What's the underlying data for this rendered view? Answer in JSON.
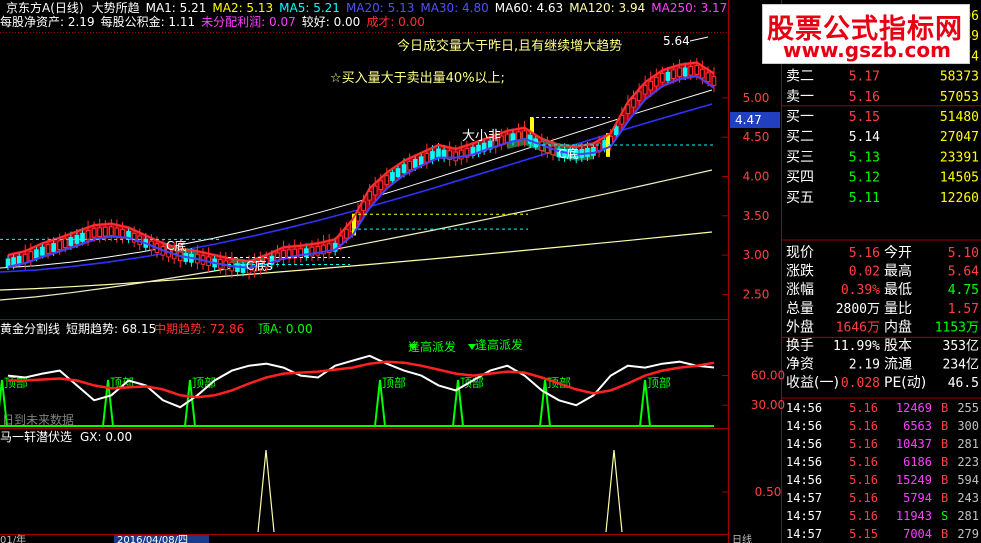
{
  "header": {
    "row1": [
      {
        "text": "京东方A(日线)",
        "color": "#ffffff"
      },
      {
        "text": "大势所趋",
        "color": "#ffffff"
      },
      {
        "text": "MA1: 5.21",
        "color": "#ffffff"
      },
      {
        "text": "MA2: 5.13",
        "color": "#ffff00"
      },
      {
        "text": "MA5: 5.21",
        "color": "#00ffff"
      },
      {
        "text": "MA20: 5.13",
        "color": "#5050ff"
      },
      {
        "text": "MA30: 4.80",
        "color": "#5050ff"
      },
      {
        "text": "MA60: 4.63",
        "color": "#ffffff"
      },
      {
        "text": "MA120: 3.94",
        "color": "#ffffaa"
      },
      {
        "text": "MA250: 3.17",
        "color": "#ff40ff"
      }
    ],
    "row2": [
      {
        "text": "每股净资产: 2.19",
        "color": "#ffffff"
      },
      {
        "text": "每股公积金: 1.11",
        "color": "#ffffff"
      },
      {
        "text": "未分配利润: 0.07",
        "color": "#ff40ff"
      },
      {
        "text": "较好: 0.00",
        "color": "#ffffff"
      },
      {
        "text": "成才: 0.00",
        "color": "#ff3030"
      }
    ]
  },
  "annotations": {
    "volume_note": "今日成交量大于昨日,且有继续增大趋势",
    "buy_note": "☆买入量大于卖出量40%以上;",
    "da_xiao_fei": "大小非",
    "c_di": "C底",
    "c_di_alt": "C底s",
    "high_label": "5.64",
    "price_tag": "4.47",
    "future_note": "日到未来数据"
  },
  "panes": {
    "mid": {
      "title": "黄金分割线",
      "short_label": "短期趋势: 68.15",
      "mid_label": "中期趋势: 72.86",
      "top_label": "顶A: 0.00",
      "ding": "顶部",
      "peak_note": "逢高派发"
    },
    "bottom": {
      "title": "马一轩潜伏选",
      "gx": "GX: 0.00"
    }
  },
  "axis": {
    "date_label": "2016/04/08/四",
    "left_label": "01/年",
    "right_label": "日线"
  },
  "chart_data": {
    "type": "line",
    "title": "京东方A(日线)",
    "y_price_ticks": [
      "5.00",
      "4.50",
      "4.00",
      "3.50",
      "3.00",
      "2.50"
    ],
    "y_mid_ticks": [
      "60.00",
      "30.00"
    ],
    "y_bottom_ticks": [
      "0.50"
    ],
    "price_range": [
      2.2,
      5.8
    ],
    "high_mark": 5.64,
    "last_price": 4.47,
    "series": [
      {
        "name": "MA1",
        "values": [
          2.9,
          2.95,
          3.05,
          3.12,
          3.2,
          3.28,
          3.3,
          3.25,
          3.15,
          3.05,
          2.98,
          2.95,
          2.9,
          2.85,
          2.82,
          2.9,
          3.0,
          3.02,
          3.05,
          3.1,
          3.35,
          3.75,
          3.95,
          4.1,
          4.2,
          4.3,
          4.25,
          4.32,
          4.4,
          4.48,
          4.52,
          4.38,
          4.3,
          4.28,
          4.32,
          4.45,
          4.85,
          5.1,
          5.25,
          5.32,
          5.35,
          5.21
        ]
      },
      {
        "name": "MA2",
        "values": [
          2.85,
          2.9,
          2.98,
          3.05,
          3.12,
          3.2,
          3.24,
          3.22,
          3.15,
          3.06,
          2.99,
          2.95,
          2.9,
          2.86,
          2.84,
          2.88,
          2.96,
          3.0,
          3.03,
          3.07,
          3.25,
          3.6,
          3.85,
          4.02,
          4.14,
          4.24,
          4.24,
          4.28,
          4.36,
          4.43,
          4.48,
          4.4,
          4.32,
          4.28,
          4.3,
          4.38,
          4.7,
          4.98,
          5.15,
          5.24,
          5.28,
          5.13
        ]
      }
    ],
    "mid_series": [
      {
        "name": "短期趋势",
        "values": [
          60,
          58,
          62,
          65,
          50,
          35,
          40,
          55,
          50,
          35,
          28,
          40,
          55,
          65,
          70,
          72,
          68,
          60,
          58,
          70,
          75,
          80,
          72,
          65,
          60,
          50,
          45,
          55,
          65,
          70,
          60,
          45,
          35,
          30,
          40,
          60,
          70,
          68,
          72,
          74,
          70,
          68.15
        ]
      },
      {
        "name": "中期趋势",
        "values": [
          55,
          55,
          56,
          57,
          55,
          50,
          47,
          48,
          49,
          46,
          40,
          38,
          40,
          45,
          52,
          58,
          62,
          63,
          64,
          66,
          68,
          72,
          74,
          73,
          70,
          66,
          62,
          60,
          62,
          64,
          63,
          58,
          52,
          46,
          42,
          45,
          52,
          60,
          65,
          68,
          70,
          72.86
        ]
      }
    ]
  },
  "quote": {
    "sell": [
      {
        "label": "卖五",
        "price": "5.20",
        "vol": "26296"
      },
      {
        "label": "卖四",
        "price": "5.19",
        "vol": "20349"
      },
      {
        "label": "卖三",
        "price": "5.18",
        "vol": "42474"
      },
      {
        "label": "卖二",
        "price": "5.17",
        "vol": "58373"
      },
      {
        "label": "卖一",
        "price": "5.16",
        "vol": "57053"
      }
    ],
    "buy": [
      {
        "label": "买一",
        "price": "5.15",
        "vol": "51480"
      },
      {
        "label": "买二",
        "price": "5.14",
        "vol": "27047"
      },
      {
        "label": "买三",
        "price": "5.13",
        "vol": "23391"
      },
      {
        "label": "买四",
        "price": "5.12",
        "vol": "14505"
      },
      {
        "label": "买五",
        "price": "5.11",
        "vol": "12260"
      }
    ],
    "stats": [
      {
        "l1": "现价",
        "v1": "5.16",
        "l2": "今开",
        "v2": "5.10"
      },
      {
        "l1": "涨跌",
        "v1": "0.02",
        "l2": "最高",
        "v2": "5.64"
      },
      {
        "l1": "涨幅",
        "v1": "0.39%",
        "l2": "最低",
        "v2": "4.75"
      },
      {
        "l1": "总量",
        "v1": "2800万",
        "l2": "量比",
        "v2": "1.57"
      },
      {
        "l1": "外盘",
        "v1": "1646万",
        "l2": "内盘",
        "v2": "1153万"
      },
      {
        "l1": "换手",
        "v1": "11.99%",
        "l2": "股本",
        "v2": "353亿"
      },
      {
        "l1": "净资",
        "v1": "2.19",
        "l2": "流通",
        "v2": "234亿"
      },
      {
        "l1": "收益(一)",
        "v1": "0.028",
        "l2": "PE(动)",
        "v2": "46.5"
      }
    ],
    "ticks": [
      {
        "time": "14:56",
        "price": "5.16",
        "vol": "12469",
        "bs": "B",
        "n": "255"
      },
      {
        "time": "14:56",
        "price": "5.16",
        "vol": "6563",
        "bs": "B",
        "n": "300"
      },
      {
        "time": "14:56",
        "price": "5.16",
        "vol": "10437",
        "bs": "B",
        "n": "281"
      },
      {
        "time": "14:56",
        "price": "5.16",
        "vol": "6186",
        "bs": "B",
        "n": "223"
      },
      {
        "time": "14:56",
        "price": "5.16",
        "vol": "15249",
        "bs": "B",
        "n": "594"
      },
      {
        "time": "14:57",
        "price": "5.16",
        "vol": "5794",
        "bs": "B",
        "n": "243"
      },
      {
        "time": "14:57",
        "price": "5.16",
        "vol": "11943",
        "bs": "S",
        "n": "281"
      },
      {
        "time": "14:57",
        "price": "5.15",
        "vol": "7004",
        "bs": "B",
        "n": "279"
      }
    ]
  },
  "watermark": {
    "line1": "股票公式指标网",
    "line2": "www.gszb.com"
  }
}
